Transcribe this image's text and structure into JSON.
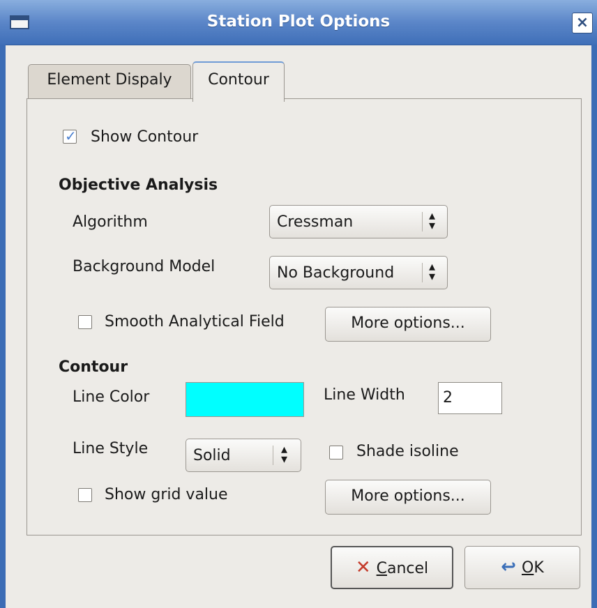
{
  "window": {
    "title": "Station Plot Options",
    "close_glyph": "×"
  },
  "tabs": [
    {
      "label": "Element Dispaly"
    },
    {
      "label": "Contour"
    }
  ],
  "show_contour": {
    "label": "Show Contour",
    "checked": true
  },
  "objective_analysis": {
    "heading": "Objective Analysis",
    "algorithm_label": "Algorithm",
    "algorithm_value": "Cressman",
    "background_label": "Background Model",
    "background_value": "No Background",
    "smooth_label": "Smooth Analytical Field",
    "smooth_checked": false,
    "more_options_label": "More options..."
  },
  "contour": {
    "heading": "Contour",
    "line_color_label": "Line Color",
    "line_color_value": "#00ffff",
    "line_width_label": "Line Width",
    "line_width_value": "2",
    "line_style_label": "Line Style",
    "line_style_value": "Solid",
    "shade_isoline_label": "Shade isoline",
    "shade_isoline_checked": false,
    "show_grid_label": "Show grid value",
    "show_grid_checked": false,
    "more_options_label": "More options..."
  },
  "footer": {
    "cancel_label_prefix": "",
    "cancel_mnemonic": "C",
    "cancel_label_rest": "ancel",
    "ok_mnemonic": "O",
    "ok_label_rest": "K"
  },
  "icons": {
    "cancel": "cancel-x-icon",
    "ok": "ok-arrow-icon",
    "combo_arrows": "up-down-arrows-icon"
  }
}
